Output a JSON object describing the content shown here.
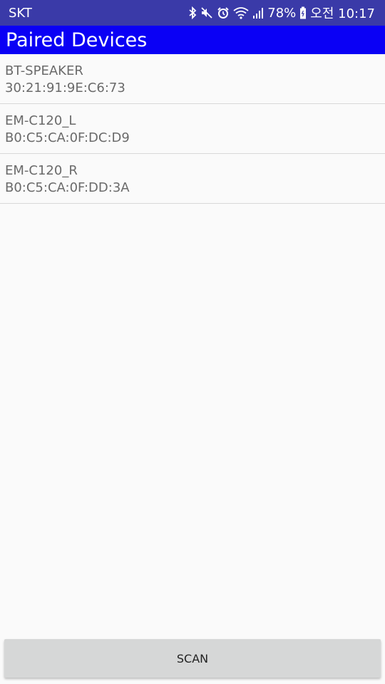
{
  "status_bar": {
    "carrier": "SKT",
    "battery": "78%",
    "time": "오전 10:17",
    "icons": [
      "bluetooth-icon",
      "mute-icon",
      "alarm-icon",
      "wifi-icon",
      "signal-icon",
      "battery-icon"
    ]
  },
  "app_bar": {
    "title": "Paired Devices",
    "color": "#0a00f5"
  },
  "devices": [
    {
      "name": "BT-SPEAKER",
      "address": "30:21:91:9E:C6:73"
    },
    {
      "name": "EM-C120_L",
      "address": "B0:C5:CA:0F:DC:D9"
    },
    {
      "name": "EM-C120_R",
      "address": "B0:C5:CA:0F:DD:3A"
    }
  ],
  "scan_button": {
    "label": "SCAN"
  }
}
